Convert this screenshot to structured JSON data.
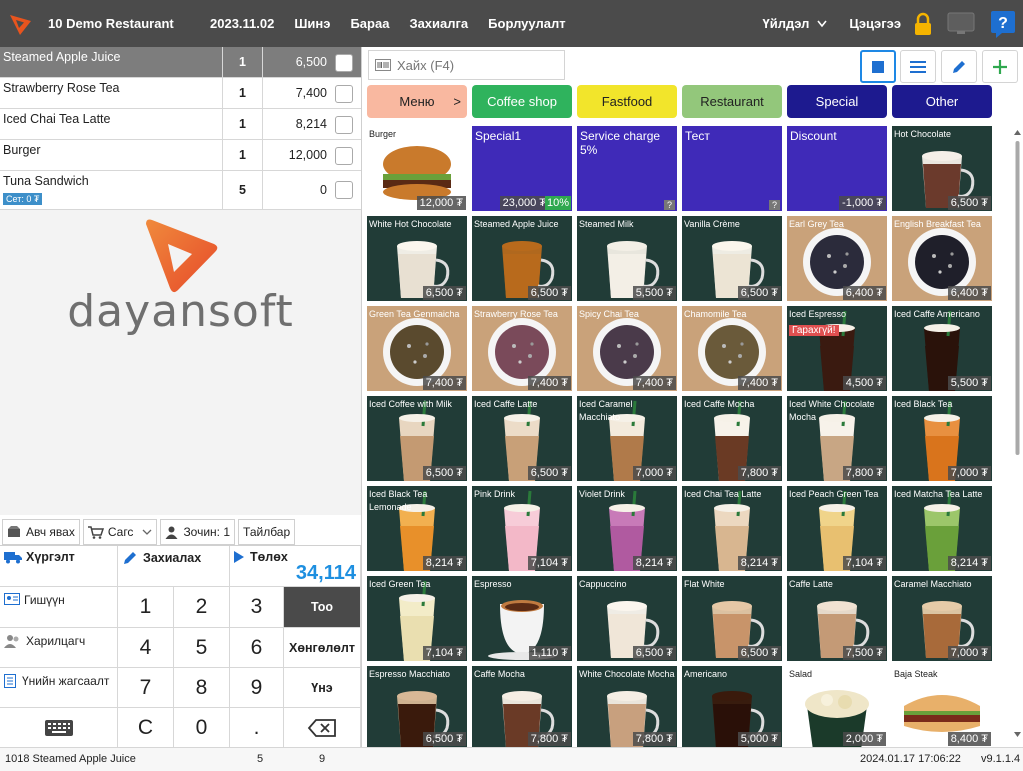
{
  "app": {
    "restaurant": "10 Demo Restaurant",
    "date": "2023.11.02",
    "nav": [
      "Шинэ",
      "Бараа",
      "Захиалга",
      "Борлуулалт"
    ],
    "operations": "Үйлдэл",
    "user": "Цэцэгээ"
  },
  "order": {
    "items": [
      {
        "name": "Steamed Apple Juice",
        "qty": "1",
        "amount": "6,500",
        "selected": true
      },
      {
        "name": "Strawberry Rose Tea",
        "qty": "1",
        "amount": "7,400"
      },
      {
        "name": "Iced Chai Tea Latte",
        "qty": "1",
        "amount": "8,214"
      },
      {
        "name": "Burger",
        "qty": "1",
        "amount": "12,000"
      },
      {
        "name": "Tuna Sandwich",
        "qty": "5",
        "amount": "0",
        "badge": "Сет: 0 ₮"
      }
    ],
    "brand": "dayansoft"
  },
  "toolbar": {
    "takeaway": "Авч явах",
    "cart": "Сагс",
    "guests": "Зочин: 1",
    "note": "Тайлбар"
  },
  "pad": {
    "delivery": "Хүргэлт",
    "order": "Захиалах",
    "pay": "Төлөх",
    "total": "34,114",
    "member": "Гишүүн",
    "customer": "Харилцагч",
    "price_list": "Үнийн жагсаалт",
    "qty": "Тоо",
    "discount": "Хөнгөлөлт",
    "price": "Үнэ",
    "keys": [
      "1",
      "2",
      "3",
      "4",
      "5",
      "6",
      "7",
      "8",
      "9",
      "C",
      "0",
      "."
    ]
  },
  "search": {
    "placeholder": "Хайх (F4)"
  },
  "categories": [
    {
      "label": "Меню",
      "chev": ">",
      "color": "#f9b8a0",
      "fg": "#222"
    },
    {
      "label": "Coffee shop",
      "color": "#2fb35d",
      "fg": "#fff"
    },
    {
      "label": "Fastfood",
      "color": "#f2e52b",
      "fg": "#222"
    },
    {
      "label": "Restaurant",
      "color": "#93c77b",
      "fg": "#222"
    },
    {
      "label": "Special",
      "color": "#1d1a8f",
      "fg": "#fff"
    },
    {
      "label": "Other",
      "color": "#1d1a8f",
      "fg": "#fff"
    }
  ],
  "products": [
    {
      "name": "Burger",
      "price": "12,000 ₮",
      "img": "burger"
    },
    {
      "name": "Special1",
      "price": "23,000 ₮",
      "badge": "10%",
      "img": "purple"
    },
    {
      "name": "Service charge 5%",
      "price": "?",
      "img": "purple"
    },
    {
      "name": "Тест",
      "price": "?",
      "img": "purple"
    },
    {
      "name": "Discount",
      "price": "-1,000 ₮",
      "img": "purple"
    },
    {
      "name": "Hot Chocolate",
      "price": "6,500 ₮",
      "img": "mug",
      "c1": "#6b3a2c",
      "c2": "#f5efe8"
    },
    {
      "name": "White Hot Chocolate",
      "price": "6,500 ₮",
      "img": "mug",
      "c1": "#e8e0d2",
      "c2": "#fbf7ee"
    },
    {
      "name": "Steamed Apple Juice",
      "price": "6,500 ₮",
      "img": "mug",
      "c1": "#b86a1c",
      "c2": "#b86a1c"
    },
    {
      "name": "Steamed Milk",
      "price": "5,500 ₮",
      "img": "mug",
      "c1": "#f3efe6",
      "c2": "#f3efe6"
    },
    {
      "name": "Vanilla Crème",
      "price": "6,500 ₮",
      "img": "mug",
      "c1": "#ece4d4",
      "c2": "#faf6ec"
    },
    {
      "name": "Earl Grey Tea",
      "price": "6,400 ₮",
      "img": "bowl",
      "c1": "#2b2b3b"
    },
    {
      "name": "English Breakfast Tea",
      "price": "6,400 ₮",
      "img": "bowl",
      "c1": "#1f1f2a"
    },
    {
      "name": "Green Tea Genmaicha",
      "price": "7,400 ₮",
      "img": "bowl",
      "c1": "#5a4a2e"
    },
    {
      "name": "Strawberry Rose Tea",
      "price": "7,400 ₮",
      "img": "bowl",
      "c1": "#7a4a5a"
    },
    {
      "name": "Spicy Chai Tea",
      "price": "7,400 ₮",
      "img": "bowl",
      "c1": "#4a3a4a"
    },
    {
      "name": "Chamomile Tea",
      "price": "7,400 ₮",
      "img": "bowl",
      "c1": "#6a5a3a"
    },
    {
      "name": "Iced Espresso",
      "price": "4,500 ₮",
      "tag": "Гарахгүй!",
      "img": "glass",
      "c1": "#3a1a10",
      "c2": "#3a1a10"
    },
    {
      "name": "Iced Caffe Americano",
      "price": "5,500 ₮",
      "img": "glass",
      "c1": "#2a120a",
      "c2": "#2a120a"
    },
    {
      "name": "Iced Coffee with Milk",
      "price": "6,500 ₮",
      "img": "glass",
      "c1": "#c49a72",
      "c2": "#e8d6c0"
    },
    {
      "name": "Iced Caffe Latte",
      "price": "6,500 ₮",
      "img": "glass",
      "c1": "#c8a078",
      "c2": "#ecdcc8"
    },
    {
      "name": "Iced Caramel Macchiato",
      "price": "7,000 ₮",
      "img": "glass",
      "c1": "#b07a4a",
      "c2": "#f3eadc"
    },
    {
      "name": "Iced Caffe Mocha",
      "price": "7,800 ₮",
      "img": "glass",
      "c1": "#6a3a24",
      "c2": "#f7f2ea"
    },
    {
      "name": "Iced White Chocolate Mocha",
      "price": "7,800 ₮",
      "img": "glass",
      "c1": "#c8a684",
      "c2": "#f7f2ea"
    },
    {
      "name": "Iced Black Tea",
      "price": "7,000 ₮",
      "img": "glass",
      "c1": "#d9741c",
      "c2": "#e89040"
    },
    {
      "name": "Iced Black Tea Lemonade",
      "price": "8,214 ₮",
      "img": "glass",
      "c1": "#e8902a",
      "c2": "#f2b050"
    },
    {
      "name": "Pink Drink",
      "price": "7,104 ₮",
      "img": "glass",
      "c1": "#f3b8c8",
      "c2": "#f7ccd8"
    },
    {
      "name": "Violet Drink",
      "price": "8,214 ₮",
      "img": "glass",
      "c1": "#b05aa0",
      "c2": "#c87ab8"
    },
    {
      "name": "Iced Chai Tea Latte",
      "price": "8,214 ₮",
      "img": "glass",
      "c1": "#d8b690",
      "c2": "#ecd8c0"
    },
    {
      "name": "Iced Peach Green Tea",
      "price": "7,104 ₮",
      "img": "glass",
      "c1": "#e8c070",
      "c2": "#f0d48a"
    },
    {
      "name": "Iced Matcha Tea Latte",
      "price": "8,214 ₮",
      "img": "glass",
      "c1": "#6aa03a",
      "c2": "#9cc66a"
    },
    {
      "name": "Iced Green Tea",
      "price": "7,104 ₮",
      "img": "glass",
      "c1": "#eadfb0",
      "c2": "#f3ecc8"
    },
    {
      "name": "Espresso",
      "price": "1,110 ₮",
      "img": "cup",
      "c1": "#5a2a14",
      "c2": "#c07a40"
    },
    {
      "name": "Cappuccino",
      "price": "6,500 ₮",
      "img": "mug",
      "c1": "#f0e6d8",
      "c2": "#fbf6ee"
    },
    {
      "name": "Flat White",
      "price": "6,500 ₮",
      "img": "mug",
      "c1": "#c8946a",
      "c2": "#e6c8a6"
    },
    {
      "name": "Caffe Latte",
      "price": "7,500 ₮",
      "img": "mug",
      "c1": "#c49a76",
      "c2": "#f0e2d2"
    },
    {
      "name": "Caramel Macchiato",
      "price": "7,000 ₮",
      "img": "mug",
      "c1": "#a86a3a",
      "c2": "#e6cba8"
    },
    {
      "name": "Espresso Macchiato",
      "price": "6,500 ₮",
      "img": "mug",
      "c1": "#3a1a0c",
      "c2": "#d8b896"
    },
    {
      "name": "Caffe Mocha",
      "price": "7,800 ₮",
      "img": "mug",
      "c1": "#6a3a26",
      "c2": "#f5eee4"
    },
    {
      "name": "White Chocolate Mocha",
      "price": "7,800 ₮",
      "img": "mug",
      "c1": "#c8a07e",
      "c2": "#f5eee4"
    },
    {
      "name": "Americano",
      "price": "5,000 ₮",
      "img": "mug",
      "c1": "#2a1008",
      "c2": "#3a1a0c"
    },
    {
      "name": "Salad",
      "price": "2,000 ₮",
      "img": "salad"
    },
    {
      "name": "Baja Steak",
      "price": "8,400 ₮",
      "img": "sandwich"
    }
  ],
  "status": {
    "item": "1018 Steamed Apple Juice",
    "count1": "5",
    "count2": "9",
    "datetime": "2024.01.17 17:06:22",
    "version": "v9.1.1.4"
  }
}
